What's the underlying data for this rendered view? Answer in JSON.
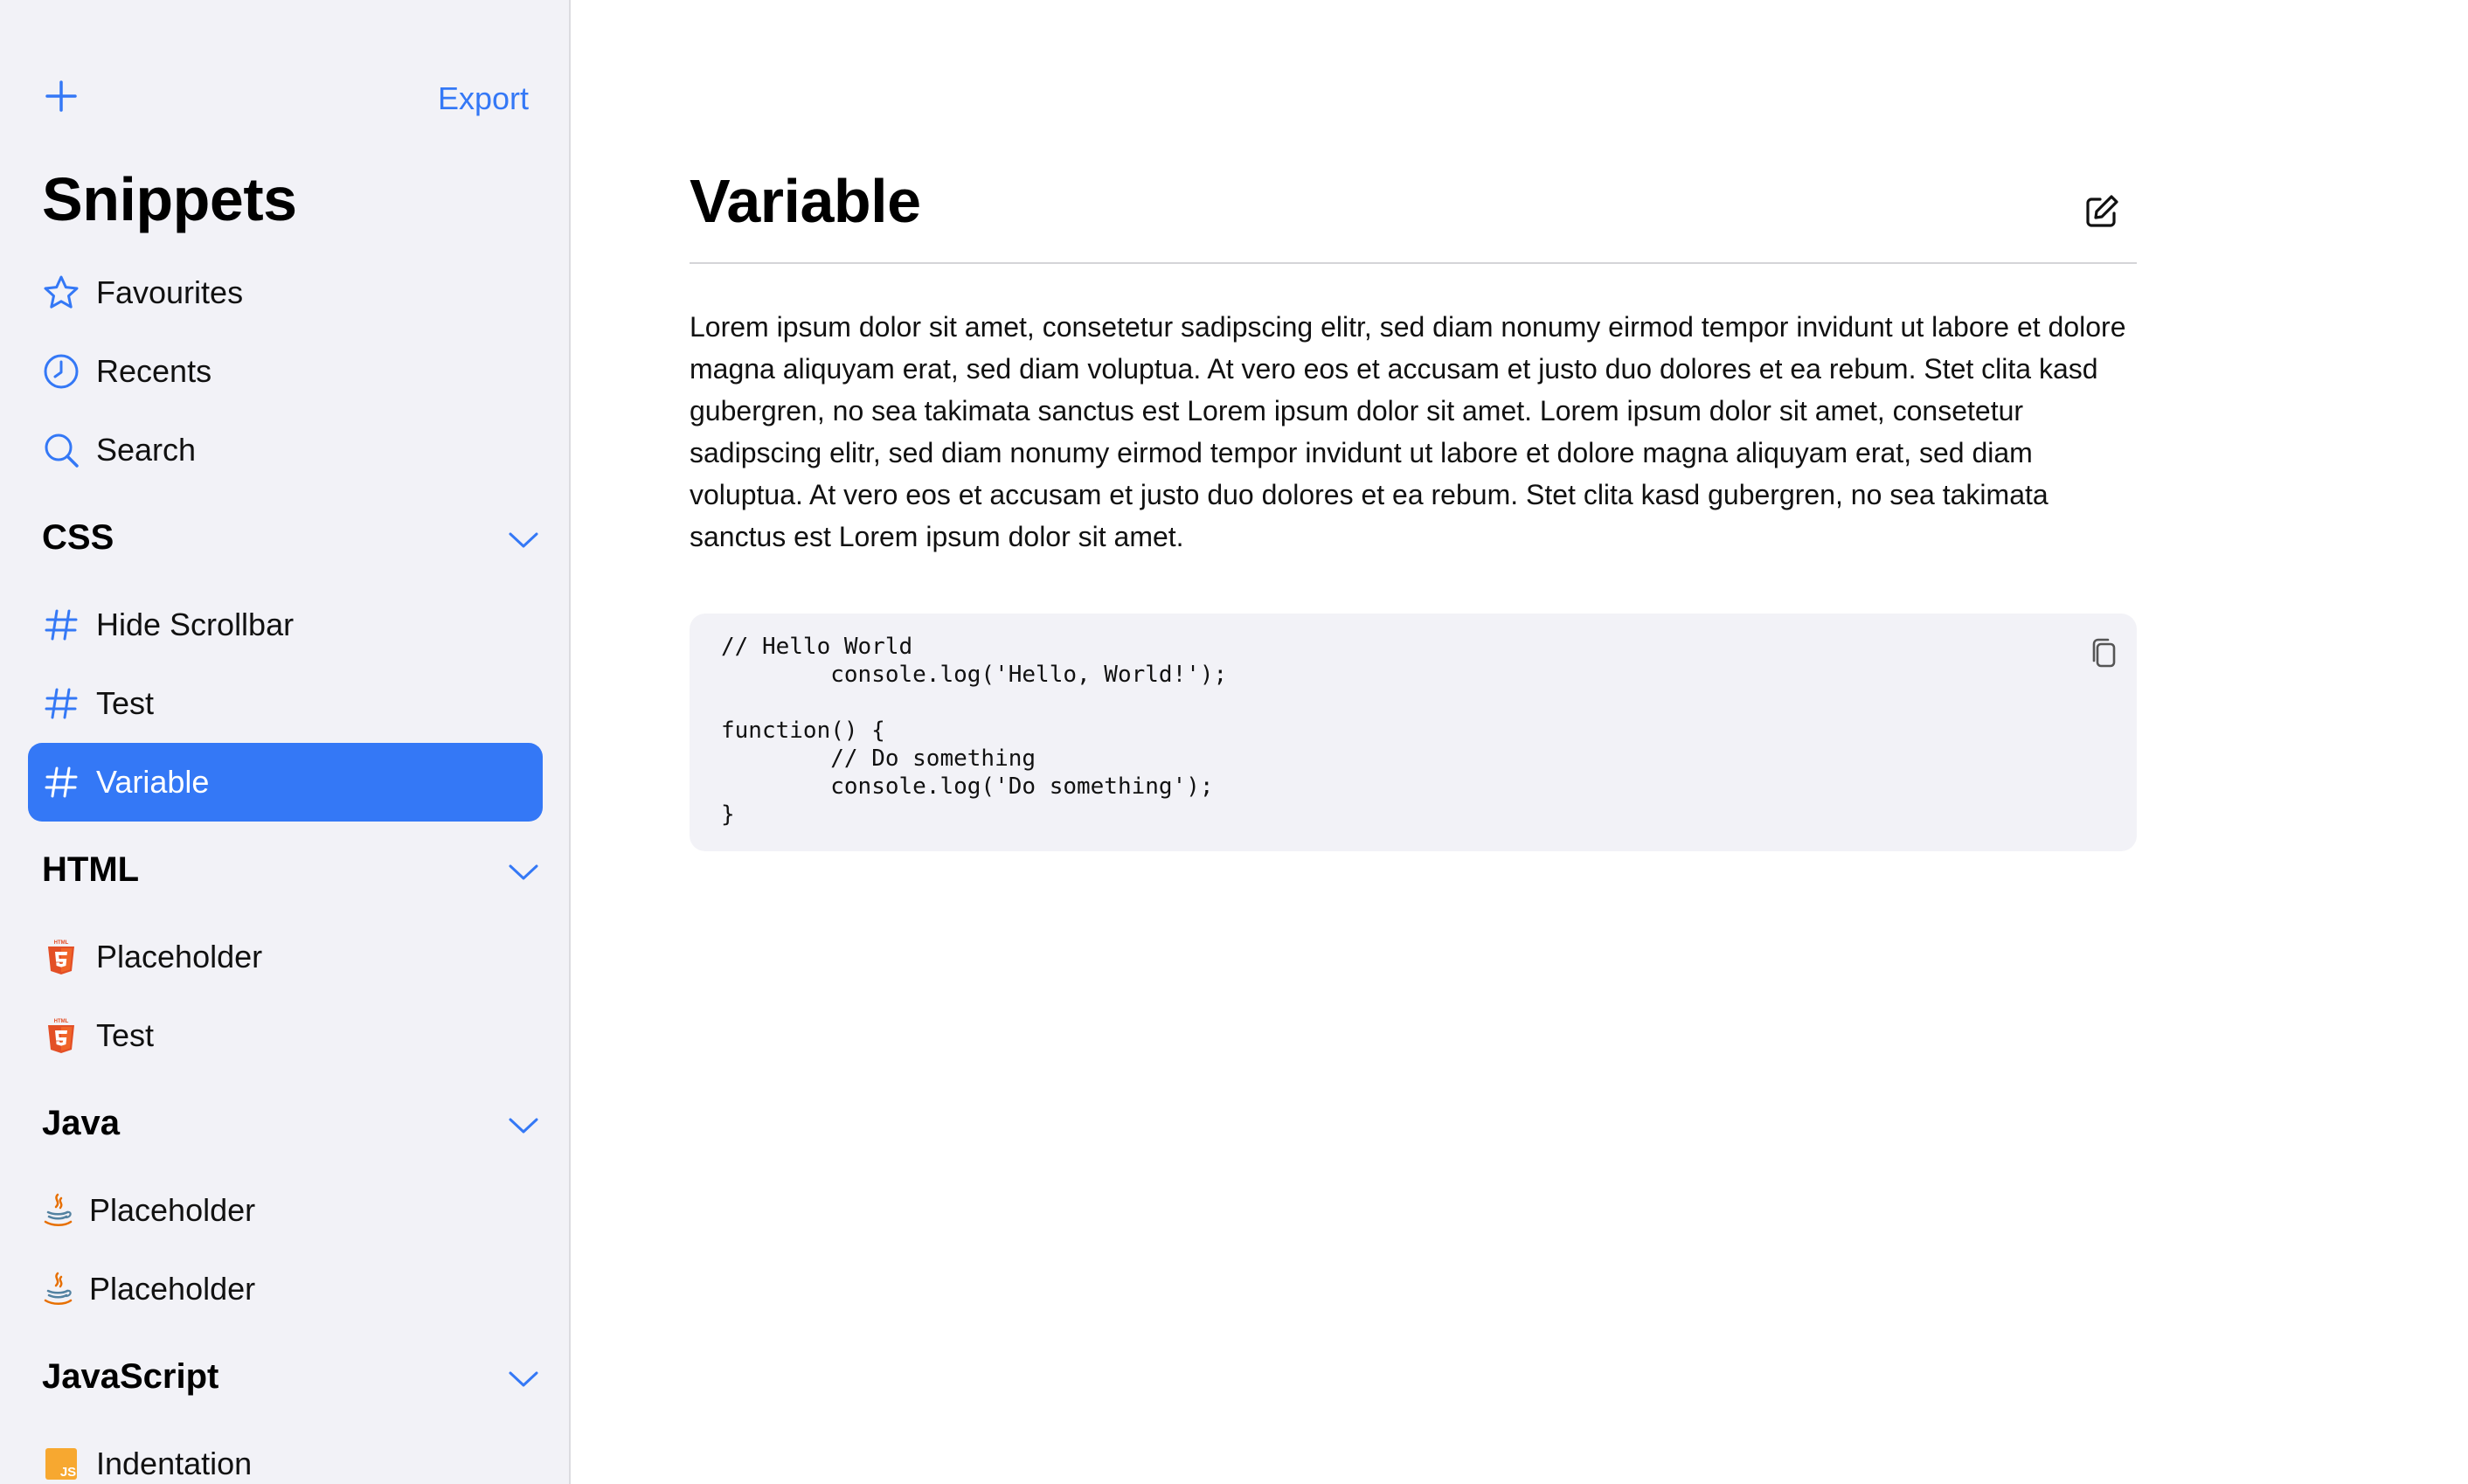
{
  "sidebar": {
    "export_label": "Export",
    "title": "Snippets",
    "quick_links": [
      {
        "label": "Favourites",
        "icon": "star-icon"
      },
      {
        "label": "Recents",
        "icon": "clock-icon"
      },
      {
        "label": "Search",
        "icon": "search-icon"
      }
    ],
    "sections": [
      {
        "label": "CSS",
        "items": [
          {
            "label": "Hide Scrollbar",
            "icon": "hash-icon"
          },
          {
            "label": "Test",
            "icon": "hash-icon"
          },
          {
            "label": "Variable",
            "icon": "hash-icon",
            "selected": true
          }
        ]
      },
      {
        "label": "HTML",
        "items": [
          {
            "label": "Placeholder",
            "icon": "html5-icon"
          },
          {
            "label": "Test",
            "icon": "html5-icon"
          }
        ]
      },
      {
        "label": "Java",
        "items": [
          {
            "label": "Placeholder",
            "icon": "java-icon"
          },
          {
            "label": "Placeholder",
            "icon": "java-icon"
          }
        ]
      },
      {
        "label": "JavaScript",
        "items": [
          {
            "label": "Indentation",
            "icon": "js-icon"
          }
        ]
      }
    ]
  },
  "main": {
    "title": "Variable",
    "description": "Lorem ipsum dolor sit amet, consetetur sadipscing elitr, sed diam nonumy eirmod tempor invidunt ut labore et dolore magna aliquyam erat, sed diam voluptua. At vero eos et accusam et justo duo dolores et ea rebum. Stet clita kasd gubergren, no sea takimata sanctus est Lorem ipsum dolor sit amet. Lorem ipsum dolor sit amet, consetetur sadipscing elitr, sed diam nonumy eirmod tempor invidunt ut labore et dolore magna aliquyam erat, sed diam voluptua. At vero eos et accusam et justo duo dolores et ea rebum. Stet clita kasd gubergren, no sea takimata sanctus est Lorem ipsum dolor sit amet.",
    "code": "// Hello World\n\tconsole.log('Hello, World!');\n\nfunction() {\n\t// Do something\n\tconsole.log('Do something');\n}"
  },
  "colors": {
    "accent": "#3478f6",
    "sidebar_bg": "#f2f2f7",
    "html5": "#e34f26",
    "java": "#e76f00",
    "js": "#f7a830"
  }
}
